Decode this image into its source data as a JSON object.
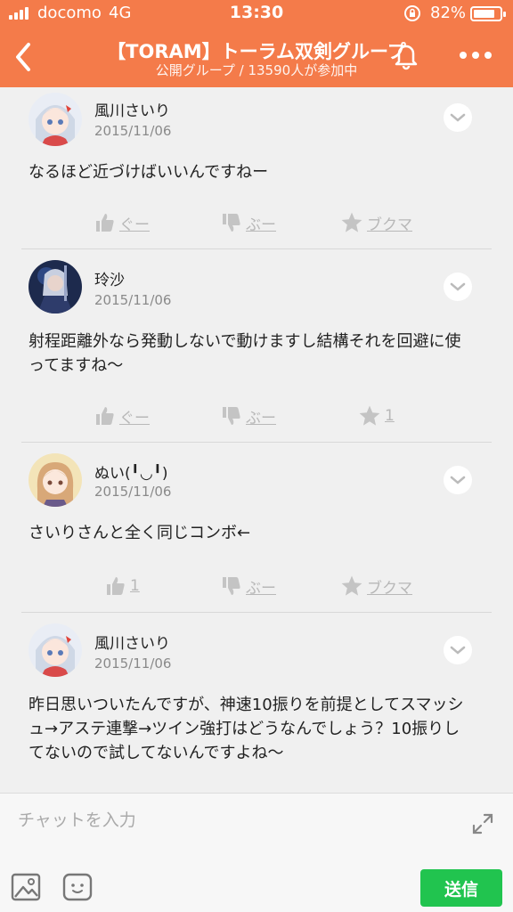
{
  "status_bar": {
    "carrier": "docomo",
    "network": "4G",
    "time": "13:30",
    "battery_percent": "82%",
    "battery_level": 0.82
  },
  "header": {
    "title": "【TORAM】トーラム双剣グループ",
    "subtitle": "公開グループ / 13590人が参加中",
    "back_icon": "chevron-left-icon",
    "bell_icon": "bell-icon",
    "more_icon": "more-icon"
  },
  "posts": [
    {
      "user": "風川さいり",
      "date": "2015/11/06",
      "text": "なるほど近づけばいいんですねー",
      "good": "ぐー",
      "boo": "ぶー",
      "bookmark": "ブクマ"
    },
    {
      "user": "玲沙",
      "date": "2015/11/06",
      "text": "射程距離外なら発動しないで動けますし結構それを回避に使ってますね〜",
      "good": "ぐー",
      "boo": "ぶー",
      "bookmark": "1"
    },
    {
      "user": "ぬい(╹◡╹)",
      "date": "2015/11/06",
      "text": "さいりさんと全く同じコンボ←",
      "good": "1",
      "boo": "ぶー",
      "bookmark": "ブクマ"
    },
    {
      "user": "風川さいり",
      "date": "2015/11/06",
      "text": "昨日思いついたんですが、神速10振りを前提としてスマッシュ→アステ連撃→ツイン強打はどうなんでしょう？10振りしてないので試してないんですよね〜"
    }
  ],
  "composer": {
    "placeholder": "チャットを入力",
    "send_label": "送信"
  },
  "colors": {
    "header": "#f47b4a",
    "send": "#21c44f",
    "muted": "#b8b8b8"
  }
}
